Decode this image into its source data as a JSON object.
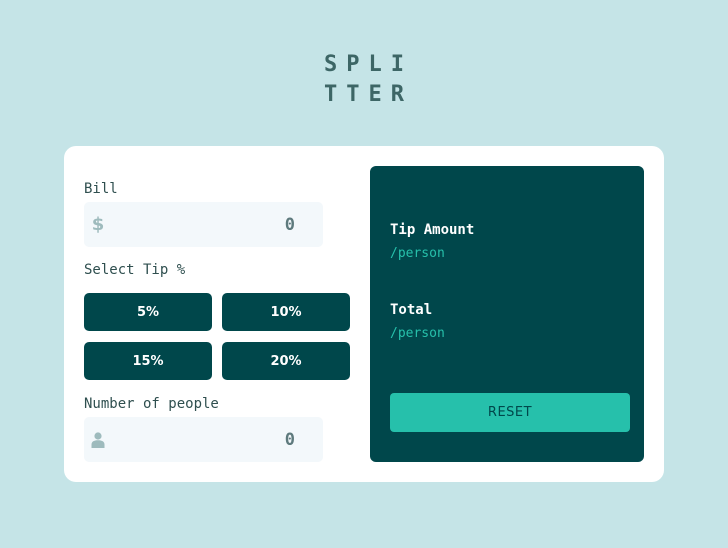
{
  "logo": {
    "line1": "SPLI",
    "line2": "TTER"
  },
  "bill": {
    "label": "Bill",
    "icon": "dollar-icon",
    "icon_glyph": "$",
    "value": "0"
  },
  "tip": {
    "label": "Select Tip %",
    "options": [
      "5%",
      "10%",
      "15%",
      "20%"
    ]
  },
  "people": {
    "label": "Number of people",
    "icon": "person-icon",
    "value": "0"
  },
  "results": {
    "tip_amount_label": "Tip Amount",
    "tip_amount_sub": "/person",
    "total_label": "Total",
    "total_sub": "/person",
    "reset_label": "RESET"
  },
  "colors": {
    "background": "#c5e4e7",
    "dark_cyan": "#00474b",
    "accent": "#26c0ab",
    "field_bg": "#f3f8fb"
  }
}
